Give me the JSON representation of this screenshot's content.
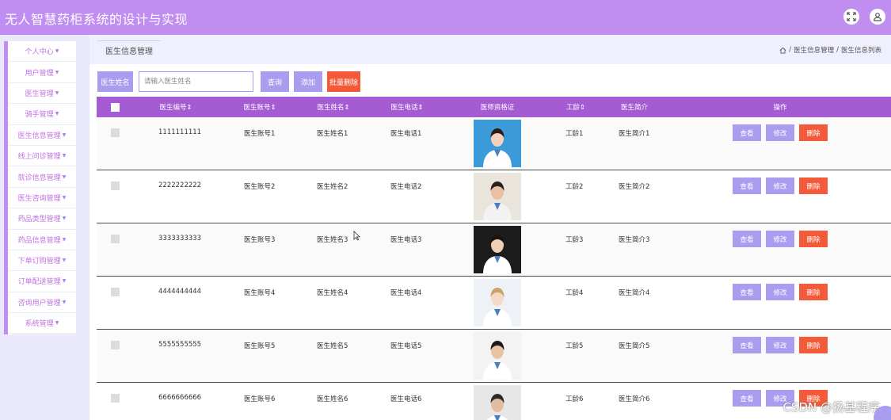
{
  "app": {
    "title": "无人智慧药柜系统的设计与实现"
  },
  "header": {
    "icons": [
      "fullscreen-icon",
      "user-icon"
    ]
  },
  "sidebar": {
    "items": [
      {
        "label": "个人中心"
      },
      {
        "label": "用户管理"
      },
      {
        "label": "医生管理"
      },
      {
        "label": "骑手管理"
      },
      {
        "label": "医生信息管理"
      },
      {
        "label": "线上问诊管理"
      },
      {
        "label": "就诊信息管理"
      },
      {
        "label": "医生咨询管理"
      },
      {
        "label": "药品类型管理"
      },
      {
        "label": "药品信息管理"
      },
      {
        "label": "下单订购管理"
      },
      {
        "label": "订单配送管理"
      },
      {
        "label": "咨询用户管理"
      },
      {
        "label": "系统管理"
      }
    ]
  },
  "page": {
    "tab_title": "医生信息管理",
    "breadcrumb": [
      "医生信息管理",
      "医生信息列表"
    ]
  },
  "search": {
    "label": "医生姓名",
    "placeholder": "请输入医生姓名",
    "value": "",
    "query_button": "查询",
    "add_button": "添加",
    "bulk_delete_button": "批量删除"
  },
  "table": {
    "headers": {
      "doctor_no": "医生编号⇕",
      "account": "医生账号⇕",
      "name": "医生姓名⇕",
      "phone": "医生电话⇕",
      "certificate": "医师资格证",
      "seniority": "工龄⇕",
      "intro": "医生简介",
      "actions": "操作"
    },
    "rows": [
      {
        "doctor_no": "1111111111",
        "account": "医生账号1",
        "name": "医生姓名1",
        "phone": "医生电话1",
        "seniority": "工龄1",
        "intro": "医生简介1"
      },
      {
        "doctor_no": "2222222222",
        "account": "医生账号2",
        "name": "医生姓名2",
        "phone": "医生电话2",
        "seniority": "工龄2",
        "intro": "医生简介2"
      },
      {
        "doctor_no": "3333333333",
        "account": "医生账号3",
        "name": "医生姓名3",
        "phone": "医生电话3",
        "seniority": "工龄3",
        "intro": "医生简介3"
      },
      {
        "doctor_no": "4444444444",
        "account": "医生账号4",
        "name": "医生姓名4",
        "phone": "医生电话4",
        "seniority": "工龄4",
        "intro": "医生简介4"
      },
      {
        "doctor_no": "5555555555",
        "account": "医生账号5",
        "name": "医生姓名5",
        "phone": "医生电话5",
        "seniority": "工龄5",
        "intro": "医生简介5"
      },
      {
        "doctor_no": "6666666666",
        "account": "医生账号6",
        "name": "医生姓名6",
        "phone": "医生电话6",
        "seniority": "工龄6",
        "intro": "医生简介6"
      }
    ],
    "row_actions": {
      "view": "查看",
      "edit": "修改",
      "delete": "删除"
    }
  },
  "watermark": "CSDN @扬基程序",
  "colors": {
    "header": "#c08ef0",
    "table_header": "#a55bd2",
    "primary_button": "#a99df0",
    "danger_button": "#f25a3a",
    "sidebar_text": "#c070e0"
  }
}
